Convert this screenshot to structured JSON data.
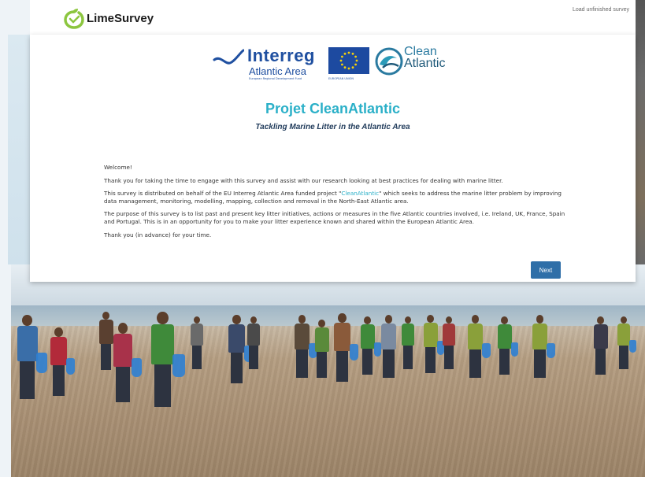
{
  "header": {
    "brand": "LimeSurvey",
    "load_link": "Load unfinished survey"
  },
  "logos": {
    "interreg_name": "Interreg",
    "interreg_area": "Atlantic Area",
    "interreg_fund": "European Regional Development Fund",
    "eu_label": "EUROPEAN UNION",
    "clean_word": "Clean",
    "atlantic_word": "Atlantic"
  },
  "survey": {
    "title": "Projet CleanAtlantic",
    "subtitle": "Tackling Marine Litter in the Atlantic Area",
    "welcome": "Welcome!",
    "para1": "Thank you for taking the time to engage with this survey and assist with our research looking at best practices for dealing with marine litter.",
    "para2_before": "This survey is distributed on behalf of the EU Interreg Atlantic Area funded project \"",
    "para2_link": "CleanAtlantic",
    "para2_after": "\" which seeks to address the marine litter problem by improving data management, monitoring, modelling, mapping, collection and removal in the North-East Atlantic area.",
    "para3": "The purpose of this survey is to list past and present key litter initiatives, actions or measures in the five Atlantic countries involved, i.e. Ireland, UK, France, Spain and Portugal. This is in an opportunity for you to make your litter experience known and shared within the European Atlantic Area.",
    "para4": "Thank you (in advance) for your time.",
    "next_label": "Next"
  },
  "colors": {
    "title": "#2bb0c8",
    "button": "#2f6fa8",
    "lime": "#8cc63f",
    "interreg_blue": "#1f4fa0"
  }
}
